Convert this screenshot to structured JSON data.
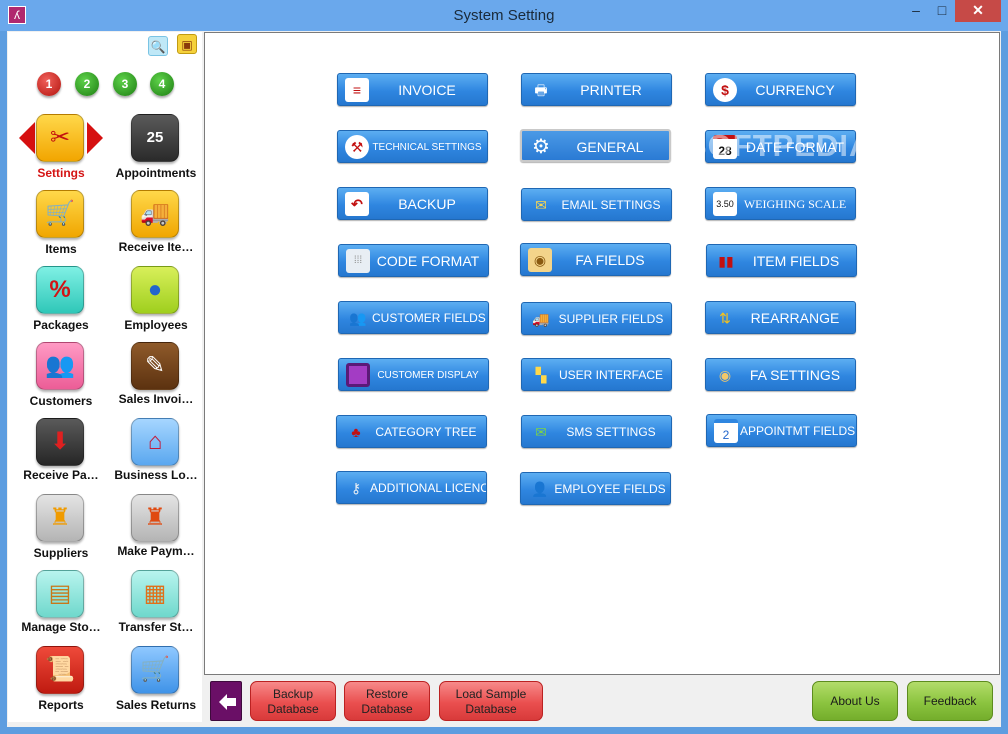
{
  "window": {
    "title": "System Setting",
    "icon": "app-logo-icon",
    "controls": {
      "minimize": "–",
      "maximize": "□",
      "close": "✕"
    }
  },
  "toolbar_icons": [
    "search-icon",
    "monitor-icon"
  ],
  "steps": [
    "1",
    "2",
    "3",
    "4"
  ],
  "sidebar": {
    "items": [
      {
        "label": "Settings",
        "icon": "settings-icon",
        "active": true
      },
      {
        "label": "Appointments",
        "icon": "calendar-icon",
        "date": "25"
      },
      {
        "label": "Items",
        "icon": "shopping-cart-icon"
      },
      {
        "label": "Receive Ite…",
        "icon": "truck-icon"
      },
      {
        "label": "Packages",
        "icon": "percent-icon",
        "glyph": "%"
      },
      {
        "label": "Employees",
        "icon": "person-icon"
      },
      {
        "label": "Customers",
        "icon": "people-icon"
      },
      {
        "label": "Sales Invoi…",
        "icon": "invoice-icon"
      },
      {
        "label": "Receive Pa…",
        "icon": "box-icon"
      },
      {
        "label": "Business Lo…",
        "icon": "building-icon"
      },
      {
        "label": "Suppliers",
        "icon": "factory-icon"
      },
      {
        "label": "Make Paym…",
        "icon": "factory-arrow-icon"
      },
      {
        "label": "Manage Sto…",
        "icon": "cart-boxes-icon"
      },
      {
        "label": "Transfer St…",
        "icon": "transfer-box-icon"
      },
      {
        "label": "Reports",
        "icon": "report-scroll-icon"
      },
      {
        "label": "Sales Returns",
        "icon": "return-cart-icon"
      }
    ]
  },
  "settings": [
    {
      "label": "INVOICE",
      "icon": "invoice-doc-icon"
    },
    {
      "label": "PRINTER",
      "icon": "printer-icon"
    },
    {
      "label": "CURRENCY",
      "icon": "dollar-icon",
      "glyph": "$"
    },
    {
      "label": "TECHNICAL SETTINGS",
      "icon": "tools-icon"
    },
    {
      "label": "GENERAL",
      "icon": "gear-icon",
      "selected": true
    },
    {
      "label": "DATE FORMAT",
      "icon": "calendar-date-icon",
      "date": "28"
    },
    {
      "label": "BACKUP",
      "icon": "undo-arrow-icon"
    },
    {
      "label": "EMAIL SETTINGS",
      "icon": "envelope-icon"
    },
    {
      "label": "WEIGHING SCALE",
      "icon": "scale-display-icon",
      "glyph": "3.50"
    },
    {
      "label": "CODE FORMAT",
      "icon": "barcode-icon"
    },
    {
      "label": "FA FIELDS",
      "icon": "coins-icon"
    },
    {
      "label": "ITEM FIELDS",
      "icon": "items-icon"
    },
    {
      "label": "CUSTOMER FIELDS",
      "icon": "customers-icon"
    },
    {
      "label": "SUPPLIER FIELDS",
      "icon": "supplier-truck-icon"
    },
    {
      "label": "REARRANGE",
      "icon": "rearrange-icon"
    },
    {
      "label": "CUSTOMER DISPLAY",
      "icon": "display-square-icon"
    },
    {
      "label": "USER INTERFACE",
      "icon": "ui-grid-icon"
    },
    {
      "label": "FA SETTINGS",
      "icon": "coin-stack-icon"
    },
    {
      "label": "CATEGORY TREE",
      "icon": "tree-icon"
    },
    {
      "label": "SMS SETTINGS",
      "icon": "sms-envelope-icon"
    },
    {
      "label": "APPOINTMT FIELDS",
      "icon": "appointment-calendar-icon",
      "glyph": "2"
    },
    {
      "label": "ADDITIONAL LICENCES",
      "icon": "key-icon"
    },
    {
      "label": "EMPLOYEE FIELDS",
      "icon": "employee-icon"
    }
  ],
  "watermark": "SOFTPEDIA",
  "bottom": {
    "backup": "Backup Database",
    "restore": "Restore Database",
    "load_sample": "Load Sample Database",
    "about": "About Us",
    "feedback": "Feedback"
  },
  "colors": {
    "accent": "#3a8ee6",
    "active_label": "#d41414",
    "danger": "#e84a4a",
    "success": "#8bc43f",
    "title_bar": "#6aa8ec"
  }
}
